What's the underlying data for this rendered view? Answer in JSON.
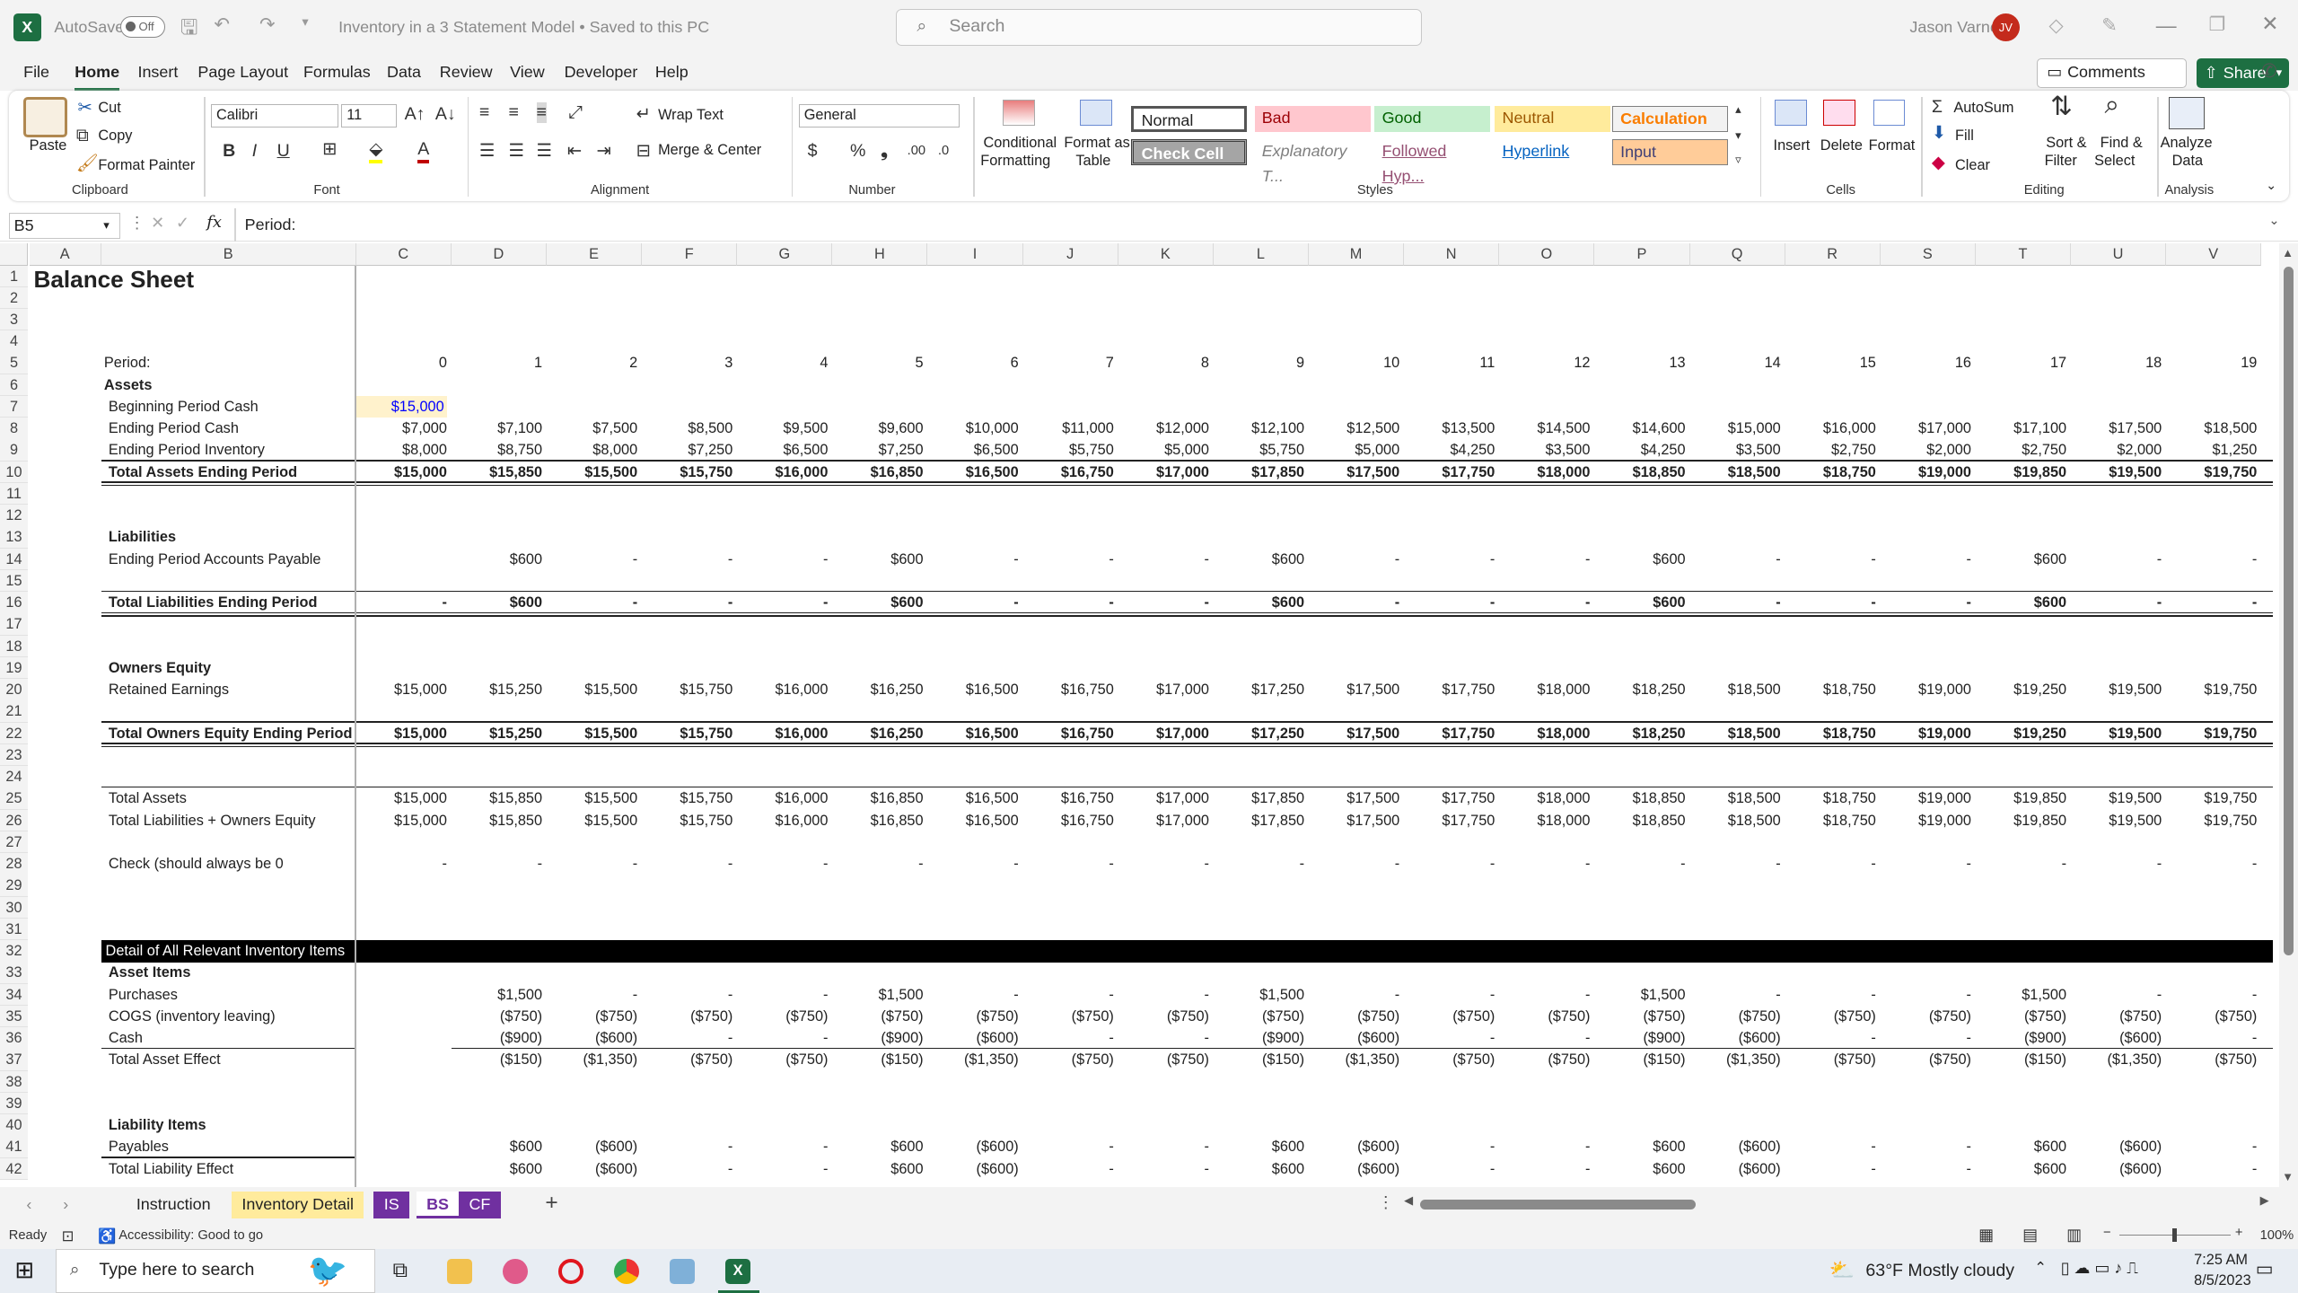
{
  "window": {
    "autosave": "AutoSave",
    "toggle": "Off",
    "title": "Inventory in a 3 Statement Model • Saved to this PC",
    "search_placeholder": "Search",
    "user": "Jason Varner",
    "initials": "JV"
  },
  "menu": [
    "File",
    "Home",
    "Insert",
    "Page Layout",
    "Formulas",
    "Data",
    "Review",
    "View",
    "Developer",
    "Help"
  ],
  "buttons": {
    "comments": "Comments",
    "share": "Share"
  },
  "ribbon": {
    "clipboard": {
      "paste": "Paste",
      "cut": "Cut",
      "copy": "Copy",
      "format_painter": "Format Painter",
      "title": "Clipboard"
    },
    "font": {
      "name": "Calibri",
      "size": "11",
      "title": "Font"
    },
    "alignment": {
      "wrap": "Wrap Text",
      "merge": "Merge & Center",
      "title": "Alignment"
    },
    "number": {
      "format": "General",
      "title": "Number"
    },
    "styles": {
      "conditional_1": "Conditional",
      "conditional_2": "Formatting",
      "table_1": "Format as",
      "table_2": "Table",
      "normal": "Normal",
      "bad": "Bad",
      "good": "Good",
      "neutral": "Neutral",
      "calculation": "Calculation",
      "check": "Check Cell",
      "explanatory": "Explanatory T...",
      "followed": "Followed Hyp...",
      "hyperlink": "Hyperlink",
      "input": "Input",
      "title": "Styles"
    },
    "cells": {
      "insert": "Insert",
      "delete": "Delete",
      "format": "Format",
      "title": "Cells"
    },
    "editing": {
      "autosum": "AutoSum",
      "fill": "Fill",
      "clear": "Clear",
      "sort_1": "Sort &",
      "sort_2": "Filter",
      "find_1": "Find &",
      "find_2": "Select",
      "title": "Editing"
    },
    "analysis": {
      "analyze_1": "Analyze",
      "analyze_2": "Data",
      "title": "Analysis"
    }
  },
  "formula": {
    "name_box": "B5",
    "fx": "fx",
    "content": "Period:"
  },
  "columns": [
    "A",
    "B",
    "C",
    "D",
    "E",
    "F",
    "G",
    "H",
    "I",
    "J",
    "K",
    "L",
    "M",
    "N",
    "O",
    "P",
    "Q",
    "R",
    "S",
    "T",
    "U",
    "V"
  ],
  "rows": [
    "1",
    "2",
    "3",
    "4",
    "5",
    "6",
    "7",
    "8",
    "9",
    "10",
    "11",
    "12",
    "13",
    "14",
    "15",
    "16",
    "17",
    "18",
    "19",
    "20",
    "21",
    "22",
    "23",
    "24",
    "25",
    "26",
    "27",
    "28",
    "29",
    "30",
    "31",
    "32",
    "33",
    "34",
    "35",
    "36",
    "37",
    "38",
    "39",
    "40",
    "41",
    "42"
  ],
  "sheet": {
    "title": "Balance Sheet",
    "period_label": "Period:",
    "periods": [
      "0",
      "1",
      "2",
      "3",
      "4",
      "5",
      "6",
      "7",
      "8",
      "9",
      "10",
      "11",
      "12",
      "13",
      "14",
      "15",
      "16",
      "17",
      "18",
      "19"
    ],
    "assets_header": "Assets",
    "beginning_cash": {
      "label": "Beginning Period Cash",
      "value": "$15,000"
    },
    "lines": [
      {
        "row": 8,
        "label": "Ending Period Cash",
        "bold": false,
        "values": [
          "$7,000",
          "$7,100",
          "$7,500",
          "$8,500",
          "$9,500",
          "$9,600",
          "$10,000",
          "$11,000",
          "$12,000",
          "$12,100",
          "$12,500",
          "$13,500",
          "$14,500",
          "$14,600",
          "$15,000",
          "$16,000",
          "$17,000",
          "$17,100",
          "$17,500",
          "$18,500"
        ]
      },
      {
        "row": 9,
        "label": "Ending Period Inventory",
        "bold": false,
        "values": [
          "$8,000",
          "$8,750",
          "$8,000",
          "$7,250",
          "$6,500",
          "$7,250",
          "$6,500",
          "$5,750",
          "$5,000",
          "$5,750",
          "$5,000",
          "$4,250",
          "$3,500",
          "$4,250",
          "$3,500",
          "$2,750",
          "$2,000",
          "$2,750",
          "$2,000",
          "$1,250"
        ]
      },
      {
        "row": 10,
        "label": "Total Assets Ending Period",
        "bold": true,
        "values": [
          "$15,000",
          "$15,850",
          "$15,500",
          "$15,750",
          "$16,000",
          "$16,850",
          "$16,500",
          "$16,750",
          "$17,000",
          "$17,850",
          "$17,500",
          "$17,750",
          "$18,000",
          "$18,850",
          "$18,500",
          "$18,750",
          "$19,000",
          "$19,850",
          "$19,500",
          "$19,750"
        ]
      },
      {
        "row": 14,
        "label": "Ending Period Accounts Payable",
        "bold": false,
        "values": [
          "",
          "$600",
          "-",
          "-",
          "-",
          "$600",
          "-",
          "-",
          "-",
          "$600",
          "-",
          "-",
          "-",
          "$600",
          "-",
          "-",
          "-",
          "$600",
          "-",
          "-"
        ]
      },
      {
        "row": 16,
        "label": "Total Liabilities Ending Period",
        "bold": true,
        "values": [
          "-",
          "$600",
          "-",
          "-",
          "-",
          "$600",
          "-",
          "-",
          "-",
          "$600",
          "-",
          "-",
          "-",
          "$600",
          "-",
          "-",
          "-",
          "$600",
          "-",
          "-"
        ]
      },
      {
        "row": 20,
        "label": "Retained Earnings",
        "bold": false,
        "values": [
          "$15,000",
          "$15,250",
          "$15,500",
          "$15,750",
          "$16,000",
          "$16,250",
          "$16,500",
          "$16,750",
          "$17,000",
          "$17,250",
          "$17,500",
          "$17,750",
          "$18,000",
          "$18,250",
          "$18,500",
          "$18,750",
          "$19,000",
          "$19,250",
          "$19,500",
          "$19,750"
        ]
      },
      {
        "row": 22,
        "label": "Total Owners Equity Ending Period",
        "bold": true,
        "values": [
          "$15,000",
          "$15,250",
          "$15,500",
          "$15,750",
          "$16,000",
          "$16,250",
          "$16,500",
          "$16,750",
          "$17,000",
          "$17,250",
          "$17,500",
          "$17,750",
          "$18,000",
          "$18,250",
          "$18,500",
          "$18,750",
          "$19,000",
          "$19,250",
          "$19,500",
          "$19,750"
        ]
      },
      {
        "row": 25,
        "label": "Total Assets",
        "bold": false,
        "values": [
          "$15,000",
          "$15,850",
          "$15,500",
          "$15,750",
          "$16,000",
          "$16,850",
          "$16,500",
          "$16,750",
          "$17,000",
          "$17,850",
          "$17,500",
          "$17,750",
          "$18,000",
          "$18,850",
          "$18,500",
          "$18,750",
          "$19,000",
          "$19,850",
          "$19,500",
          "$19,750"
        ]
      },
      {
        "row": 26,
        "label": "Total Liabilities + Owners Equity",
        "bold": false,
        "values": [
          "$15,000",
          "$15,850",
          "$15,500",
          "$15,750",
          "$16,000",
          "$16,850",
          "$16,500",
          "$16,750",
          "$17,000",
          "$17,850",
          "$17,500",
          "$17,750",
          "$18,000",
          "$18,850",
          "$18,500",
          "$18,750",
          "$19,000",
          "$19,850",
          "$19,500",
          "$19,750"
        ]
      },
      {
        "row": 28,
        "label": "Check (should always be 0",
        "bold": false,
        "values": [
          "-",
          "-",
          "-",
          "-",
          "-",
          "-",
          "-",
          "-",
          "-",
          "-",
          "-",
          "-",
          "-",
          "-",
          "-",
          "-",
          "-",
          "-",
          "-",
          "-"
        ]
      },
      {
        "row": 34,
        "label": "Purchases",
        "bold": false,
        "values": [
          "",
          "$1,500",
          "-",
          "-",
          "-",
          "$1,500",
          "-",
          "-",
          "-",
          "$1,500",
          "-",
          "-",
          "-",
          "$1,500",
          "-",
          "-",
          "-",
          "$1,500",
          "-",
          "-"
        ]
      },
      {
        "row": 35,
        "label": "COGS (inventory leaving)",
        "bold": false,
        "values": [
          "",
          "($750)",
          "($750)",
          "($750)",
          "($750)",
          "($750)",
          "($750)",
          "($750)",
          "($750)",
          "($750)",
          "($750)",
          "($750)",
          "($750)",
          "($750)",
          "($750)",
          "($750)",
          "($750)",
          "($750)",
          "($750)",
          "($750)"
        ]
      },
      {
        "row": 36,
        "label": "Cash",
        "bold": false,
        "values": [
          "",
          "($900)",
          "($600)",
          "-",
          "-",
          "($900)",
          "($600)",
          "-",
          "-",
          "($900)",
          "($600)",
          "-",
          "-",
          "($900)",
          "($600)",
          "-",
          "-",
          "($900)",
          "($600)",
          "-"
        ]
      },
      {
        "row": 37,
        "label": "Total Asset Effect",
        "bold": false,
        "values": [
          "",
          "($150)",
          "($1,350)",
          "($750)",
          "($750)",
          "($150)",
          "($1,350)",
          "($750)",
          "($750)",
          "($150)",
          "($1,350)",
          "($750)",
          "($750)",
          "($150)",
          "($1,350)",
          "($750)",
          "($750)",
          "($150)",
          "($1,350)",
          "($750)"
        ]
      },
      {
        "row": 41,
        "label": "Payables",
        "bold": false,
        "values": [
          "",
          "$600",
          "($600)",
          "-",
          "-",
          "$600",
          "($600)",
          "-",
          "-",
          "$600",
          "($600)",
          "-",
          "-",
          "$600",
          "($600)",
          "-",
          "-",
          "$600",
          "($600)",
          "-"
        ]
      },
      {
        "row": 42,
        "label": "Total Liability Effect",
        "bold": false,
        "values": [
          "",
          "$600",
          "($600)",
          "-",
          "-",
          "$600",
          "($600)",
          "-",
          "-",
          "$600",
          "($600)",
          "-",
          "-",
          "$600",
          "($600)",
          "-",
          "-",
          "$600",
          "($600)",
          "-"
        ]
      }
    ],
    "liabilities_header": "Liabilities",
    "equity_header": "Owners Equity",
    "detail_header": "Detail of All Relevant Inventory Items",
    "asset_items": "Asset Items",
    "liability_items": "Liability Items"
  },
  "tabs": [
    "Instruction",
    "Inventory Detail",
    "IS",
    "BS",
    "CF"
  ],
  "status": {
    "ready": "Ready",
    "accessibility": "Accessibility: Good to go",
    "zoom": "100%"
  },
  "taskbar": {
    "search": "Type here to search",
    "weather": "63°F  Mostly cloudy",
    "time": "7:25 AM",
    "date": "8/5/2023"
  },
  "colors": {
    "excel_green": "#1d6f42",
    "input_fill": "#fff2cc",
    "header_black": "#000000",
    "tab_purple": "#7030a0",
    "tab_yellow": "#ffeb9c"
  }
}
